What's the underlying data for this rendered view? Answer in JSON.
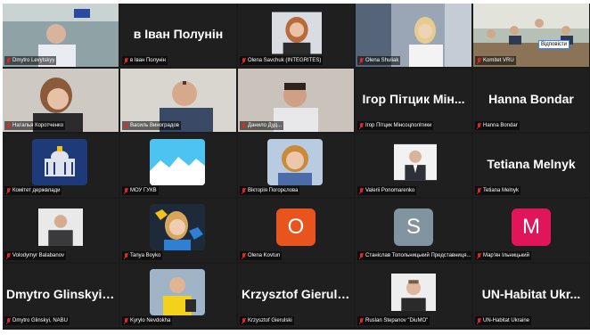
{
  "gallery": {
    "tiles": [
      {
        "label": "Dmytro Levytskyy",
        "display": "",
        "kind": "video"
      },
      {
        "label": "в Іван Полунін",
        "display": "в Іван Полунін",
        "kind": "name"
      },
      {
        "label": "Olena Savchuk (INTEGRITES)",
        "display": "",
        "kind": "avatar"
      },
      {
        "label": "Olena Shuliak",
        "display": "",
        "kind": "video"
      },
      {
        "label": "Komitet VRU",
        "display": "",
        "kind": "video",
        "reply_label": "Відповісти"
      },
      {
        "label": "Наталья Коротченко",
        "display": "",
        "kind": "video"
      },
      {
        "label": "Василь Виноградов",
        "display": "",
        "kind": "video"
      },
      {
        "label": "Данило Дуд...",
        "display": "",
        "kind": "video"
      },
      {
        "label": "Ігор Пітцик Мінсоцполітики",
        "display": "Ігор Пітцик Мін...",
        "kind": "name"
      },
      {
        "label": "Hanna Bondar",
        "display": "Hanna Bondar",
        "kind": "name"
      },
      {
        "label": "Комітет держвлади",
        "display": "",
        "kind": "avatar"
      },
      {
        "label": "МОУ ГУКВ",
        "display": "",
        "kind": "avatar"
      },
      {
        "label": "Вікторія Погорєлова",
        "display": "",
        "kind": "avatar"
      },
      {
        "label": "Valerii Ponomarenko",
        "display": "",
        "kind": "avatar"
      },
      {
        "label": "Tetiana Melnyk",
        "display": "Tetiana Melnyk",
        "kind": "name"
      },
      {
        "label": "Volodymyr Balabanov",
        "display": "",
        "kind": "avatar"
      },
      {
        "label": "Tanya Boyko",
        "display": "",
        "kind": "avatar"
      },
      {
        "label": "Olena Kovtun",
        "display": "O",
        "kind": "letter",
        "color": "#e8541e"
      },
      {
        "label": "Станіслав Топольницький Представниця...",
        "display": "S",
        "kind": "letter",
        "color": "#8394a1"
      },
      {
        "label": "Мар'ян Ільницький",
        "display": "M",
        "kind": "letter",
        "color": "#e0155a"
      },
      {
        "label": "Dmytro Glinskyi, NABU",
        "display": "Dmytro Glinskyi,...",
        "kind": "name"
      },
      {
        "label": "Kyrylo Nevdokha",
        "display": "",
        "kind": "avatar"
      },
      {
        "label": "Krzysztof Gierulski",
        "display": "Krzysztof Gierulski",
        "kind": "name"
      },
      {
        "label": "Ruslan Stepanov \"DiuMO\"",
        "display": "",
        "kind": "avatar"
      },
      {
        "label": "UN-Habitat Ukraine",
        "display": "UN-Habitat Ukr...",
        "kind": "name"
      }
    ]
  }
}
